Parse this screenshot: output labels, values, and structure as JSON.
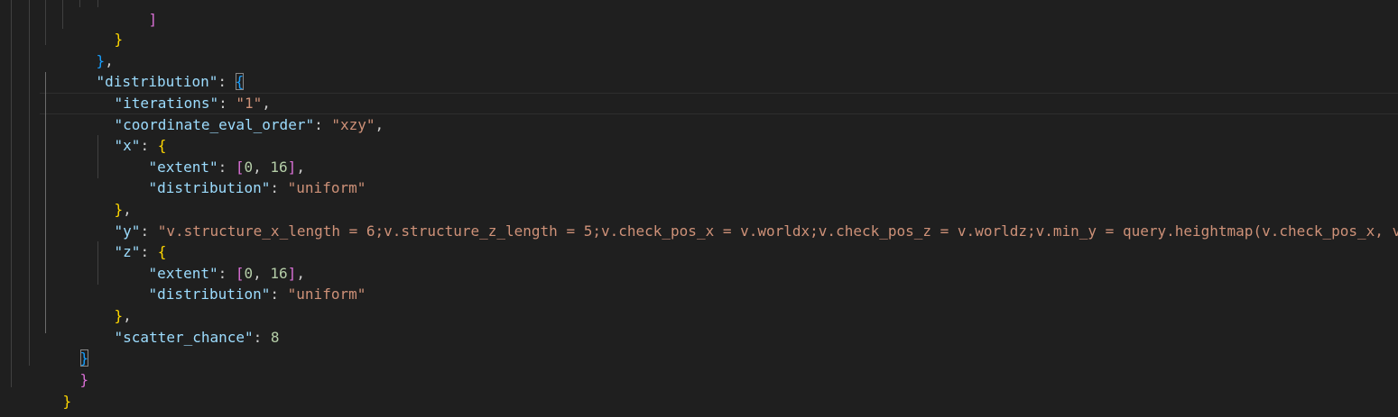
{
  "editor": {
    "lines": [
      {
        "tokens": [
          {
            "t": "b2",
            "v": "]"
          }
        ]
      },
      {
        "tokens": [
          {
            "t": "b1",
            "v": "}"
          }
        ]
      },
      {
        "tokens": [
          {
            "t": "b3",
            "v": "}"
          },
          {
            "t": "p",
            "v": ","
          }
        ]
      },
      {
        "tokens": [
          {
            "t": "k",
            "v": "\"distribution\""
          },
          {
            "t": "p",
            "v": ": "
          },
          {
            "t": "b3m",
            "v": "{"
          }
        ]
      },
      {
        "tokens": [
          {
            "t": "k",
            "v": "\"iterations\""
          },
          {
            "t": "p",
            "v": ": "
          },
          {
            "t": "s",
            "v": "\"1\""
          },
          {
            "t": "p",
            "v": ","
          }
        ]
      },
      {
        "tokens": [
          {
            "t": "k",
            "v": "\"coordinate_eval_order\""
          },
          {
            "t": "p",
            "v": ": "
          },
          {
            "t": "s",
            "v": "\"xzy\""
          },
          {
            "t": "p",
            "v": ","
          }
        ]
      },
      {
        "tokens": [
          {
            "t": "k",
            "v": "\"x\""
          },
          {
            "t": "p",
            "v": ": "
          },
          {
            "t": "b1",
            "v": "{"
          }
        ]
      },
      {
        "tokens": [
          {
            "t": "k",
            "v": "\"extent\""
          },
          {
            "t": "p",
            "v": ": "
          },
          {
            "t": "b2",
            "v": "["
          },
          {
            "t": "n",
            "v": "0"
          },
          {
            "t": "p",
            "v": ", "
          },
          {
            "t": "n",
            "v": "16"
          },
          {
            "t": "b2",
            "v": "]"
          },
          {
            "t": "p",
            "v": ","
          }
        ]
      },
      {
        "tokens": [
          {
            "t": "k",
            "v": "\"distribution\""
          },
          {
            "t": "p",
            "v": ": "
          },
          {
            "t": "s",
            "v": "\"uniform\""
          }
        ]
      },
      {
        "tokens": [
          {
            "t": "b1",
            "v": "}"
          },
          {
            "t": "p",
            "v": ","
          }
        ]
      },
      {
        "tokens": [
          {
            "t": "k",
            "v": "\"y\""
          },
          {
            "t": "p",
            "v": ": "
          },
          {
            "t": "s",
            "v": "\"v.structure_x_length = 6;v.structure_z_length = 5;v.check_pos_x = v.worldx;v.check_pos_z = v.worldz;v.min_y = query.heightmap(v.check_pos_x, v.check"
          }
        ]
      },
      {
        "tokens": [
          {
            "t": "k",
            "v": "\"z\""
          },
          {
            "t": "p",
            "v": ": "
          },
          {
            "t": "b1",
            "v": "{"
          }
        ]
      },
      {
        "tokens": [
          {
            "t": "k",
            "v": "\"extent\""
          },
          {
            "t": "p",
            "v": ": "
          },
          {
            "t": "b2",
            "v": "["
          },
          {
            "t": "n",
            "v": "0"
          },
          {
            "t": "p",
            "v": ", "
          },
          {
            "t": "n",
            "v": "16"
          },
          {
            "t": "b2",
            "v": "]"
          },
          {
            "t": "p",
            "v": ","
          }
        ]
      },
      {
        "tokens": [
          {
            "t": "k",
            "v": "\"distribution\""
          },
          {
            "t": "p",
            "v": ": "
          },
          {
            "t": "s",
            "v": "\"uniform\""
          }
        ]
      },
      {
        "tokens": [
          {
            "t": "b1",
            "v": "}"
          },
          {
            "t": "p",
            "v": ","
          }
        ]
      },
      {
        "tokens": [
          {
            "t": "k",
            "v": "\"scatter_chance\""
          },
          {
            "t": "p",
            "v": ": "
          },
          {
            "t": "n",
            "v": "8"
          }
        ]
      },
      {
        "tokens": [
          {
            "t": "b3m",
            "v": "}"
          }
        ]
      },
      {
        "tokens": [
          {
            "t": "b2",
            "v": "}"
          }
        ]
      },
      {
        "tokens": [
          {
            "t": "b1",
            "v": "}"
          }
        ]
      }
    ]
  }
}
